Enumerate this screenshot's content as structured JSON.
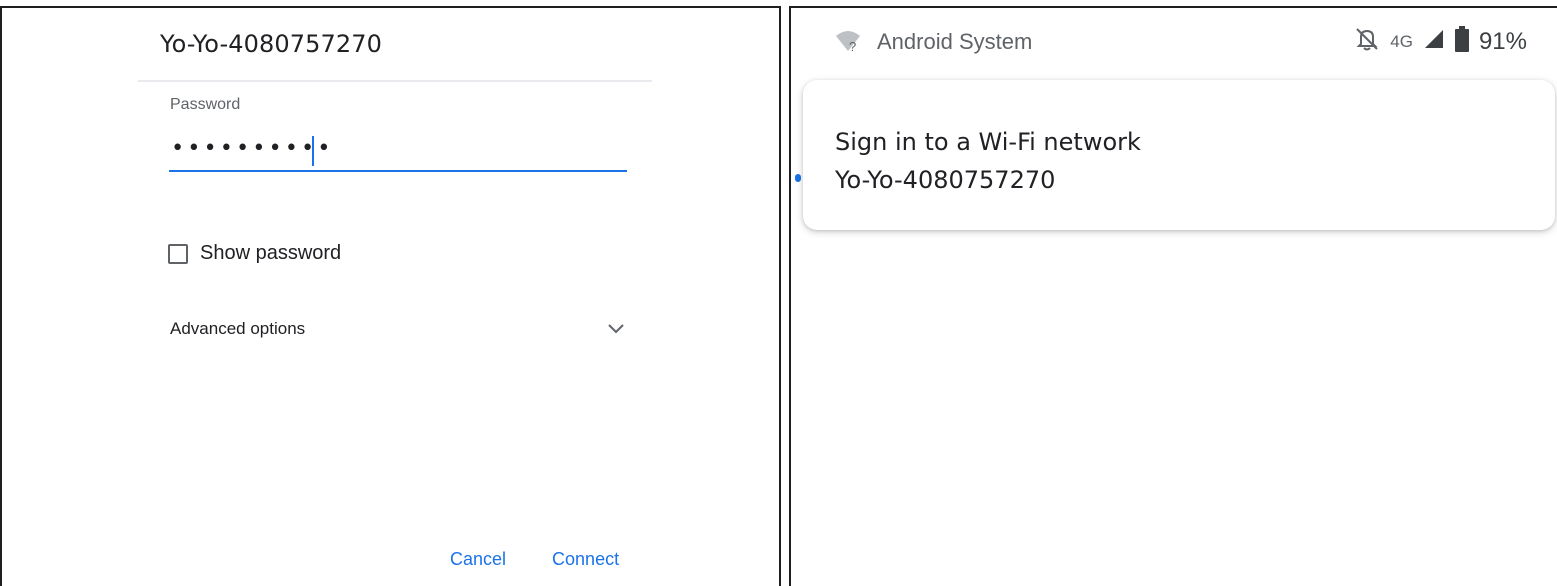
{
  "left_dialog": {
    "network_name": "Yo-Yo-4080757270",
    "password_label": "Password",
    "password_value": "••••••••••",
    "show_password_label": "Show password",
    "show_password_checked": false,
    "advanced_options_label": "Advanced options",
    "advanced_icon": "chevron-down-icon",
    "cancel_label": "Cancel",
    "connect_label": "Connect",
    "accent_color": "#1a73e8"
  },
  "right_notification": {
    "status_bar": {
      "wifi_icon": "wifi-question-icon",
      "app_name": "Android System",
      "mute_icon": "notifications-off-icon",
      "network_type": "4G",
      "signal_icon": "signal-icon",
      "battery_icon": "battery-icon",
      "battery_percent": "91%"
    },
    "card": {
      "title": "Sign in to a Wi-Fi network",
      "text": "Yo-Yo-4080757270"
    }
  }
}
